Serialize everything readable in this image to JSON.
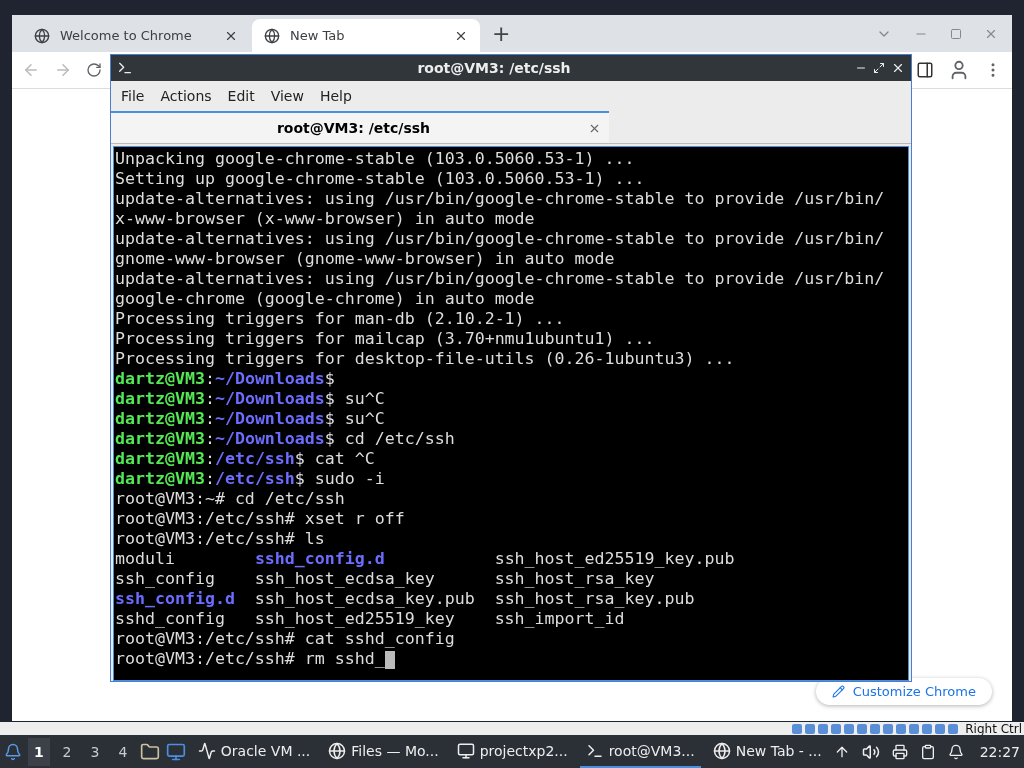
{
  "browser": {
    "tabs": [
      {
        "title": "Welcome to Chrome",
        "selected": false
      },
      {
        "title": "New Tab",
        "selected": true
      }
    ],
    "new_tab": "+",
    "customize": "Customize Chrome"
  },
  "terminal": {
    "title": "root@VM3: /etc/ssh",
    "menu": [
      "File",
      "Actions",
      "Edit",
      "View",
      "Help"
    ],
    "tabs": [
      {
        "title": "root@VM3: /etc/ssh",
        "selected": true
      }
    ],
    "lines": [
      [
        {
          "kind": "plain",
          "text": "Unpacking google-chrome-stable (103.0.5060.53-1) ..."
        }
      ],
      [
        {
          "kind": "plain",
          "text": "Setting up google-chrome-stable (103.0.5060.53-1) ..."
        }
      ],
      [
        {
          "kind": "plain",
          "text": "update-alternatives: using /usr/bin/google-chrome-stable to provide /usr/bin/"
        }
      ],
      [
        {
          "kind": "plain",
          "text": "x-www-browser (x-www-browser) in auto mode"
        }
      ],
      [
        {
          "kind": "plain",
          "text": "update-alternatives: using /usr/bin/google-chrome-stable to provide /usr/bin/"
        }
      ],
      [
        {
          "kind": "plain",
          "text": "gnome-www-browser (gnome-www-browser) in auto mode"
        }
      ],
      [
        {
          "kind": "plain",
          "text": "update-alternatives: using /usr/bin/google-chrome-stable to provide /usr/bin/"
        }
      ],
      [
        {
          "kind": "plain",
          "text": "google-chrome (google-chrome) in auto mode"
        }
      ],
      [
        {
          "kind": "plain",
          "text": "Processing triggers for man-db (2.10.2-1) ..."
        }
      ],
      [
        {
          "kind": "plain",
          "text": "Processing triggers for mailcap (3.70+nmu1ubuntu1) ..."
        }
      ],
      [
        {
          "kind": "plain",
          "text": "Processing triggers for desktop-file-utils (0.26-1ubuntu3) ..."
        }
      ],
      [
        {
          "kind": "user",
          "text": "dartz@VM3"
        },
        {
          "kind": "plain",
          "text": ":"
        },
        {
          "kind": "path",
          "text": "~/Downloads"
        },
        {
          "kind": "plain",
          "text": "$"
        }
      ],
      [
        {
          "kind": "user",
          "text": "dartz@VM3"
        },
        {
          "kind": "plain",
          "text": ":"
        },
        {
          "kind": "path",
          "text": "~/Downloads"
        },
        {
          "kind": "plain",
          "text": "$ su^C"
        }
      ],
      [
        {
          "kind": "user",
          "text": "dartz@VM3"
        },
        {
          "kind": "plain",
          "text": ":"
        },
        {
          "kind": "path",
          "text": "~/Downloads"
        },
        {
          "kind": "plain",
          "text": "$ su^C"
        }
      ],
      [
        {
          "kind": "user",
          "text": "dartz@VM3"
        },
        {
          "kind": "plain",
          "text": ":"
        },
        {
          "kind": "path",
          "text": "~/Downloads"
        },
        {
          "kind": "plain",
          "text": "$ cd /etc/ssh"
        }
      ],
      [
        {
          "kind": "user",
          "text": "dartz@VM3"
        },
        {
          "kind": "plain",
          "text": ":"
        },
        {
          "kind": "path",
          "text": "/etc/ssh"
        },
        {
          "kind": "plain",
          "text": "$ cat ^C"
        }
      ],
      [
        {
          "kind": "user",
          "text": "dartz@VM3"
        },
        {
          "kind": "plain",
          "text": ":"
        },
        {
          "kind": "path",
          "text": "/etc/ssh"
        },
        {
          "kind": "plain",
          "text": "$ sudo -i"
        }
      ],
      [
        {
          "kind": "plain",
          "text": "root@VM3:~# cd /etc/ssh"
        }
      ],
      [
        {
          "kind": "plain",
          "text": "root@VM3:/etc/ssh# xset r off"
        }
      ],
      [
        {
          "kind": "plain",
          "text": "root@VM3:/etc/ssh# ls"
        }
      ],
      [
        {
          "kind": "plain",
          "text": "moduli        "
        },
        {
          "kind": "path",
          "text": "sshd_config.d"
        },
        {
          "kind": "plain",
          "text": "           ssh_host_ed25519_key.pub"
        }
      ],
      [
        {
          "kind": "plain",
          "text": "ssh_config    ssh_host_ecdsa_key      ssh_host_rsa_key"
        }
      ],
      [
        {
          "kind": "path",
          "text": "ssh_config.d"
        },
        {
          "kind": "plain",
          "text": "  ssh_host_ecdsa_key.pub  ssh_host_rsa_key.pub"
        }
      ],
      [
        {
          "kind": "plain",
          "text": "sshd_config   ssh_host_ed25519_key    ssh_import_id"
        }
      ],
      [
        {
          "kind": "plain",
          "text": "root@VM3:/etc/ssh# cat sshd_config"
        }
      ],
      [
        {
          "kind": "plain",
          "text": "root@VM3:/etc/ssh# rm sshd_"
        }
      ]
    ]
  },
  "host_bar": {
    "key": "Right Ctrl"
  },
  "taskbar": {
    "workspaces": [
      {
        "label": "1",
        "selected": true
      },
      {
        "label": "2",
        "selected": false
      },
      {
        "label": "3",
        "selected": false
      },
      {
        "label": "4",
        "selected": false
      }
    ],
    "tasks": [
      {
        "kind": "monitor",
        "label": "Oracle VM ...",
        "selected": false
      },
      {
        "kind": "firefox",
        "label": "Files — Mo...",
        "selected": false
      },
      {
        "kind": "xp",
        "label": "projectxp2...",
        "selected": false
      },
      {
        "kind": "terminal",
        "label": "root@VM3...",
        "selected": true
      },
      {
        "kind": "chrome",
        "label": "New Tab - ...",
        "selected": false
      }
    ],
    "clock": "22:27"
  }
}
